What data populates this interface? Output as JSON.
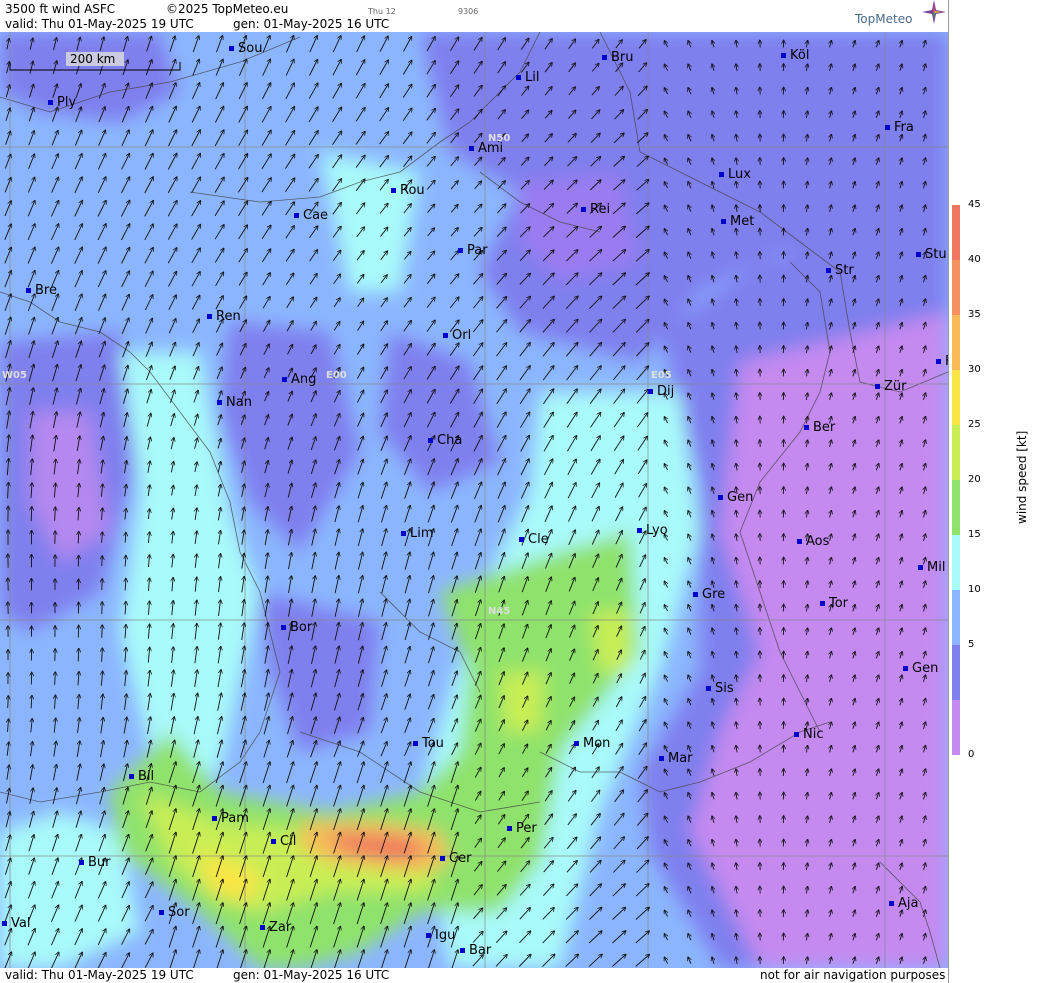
{
  "header": {
    "product": "3500 ft wind ASFC",
    "copyright": "©2025 TopMeteo.eu",
    "valid": "valid:  Thu  01-May-2025  19 UTC",
    "gen": "gen: 01-May-2025 16 UTC",
    "small_label": "Thu 12",
    "small_code": "9306",
    "logo": "TopMeteo"
  },
  "scalebar": {
    "label": "200 km"
  },
  "grid_labels": [
    "N50",
    "N45",
    "W05",
    "E00",
    "E05"
  ],
  "cities": [
    "Sou",
    "Ply",
    "Lil",
    "Bru",
    "Köl",
    "Ami",
    "Fra",
    "Lux",
    "Rou",
    "Cae",
    "Rei",
    "Met",
    "Par",
    "Stu",
    "Bre",
    "Str",
    "Ren",
    "Orl",
    "F",
    "Zür",
    "Ang",
    "Nan",
    "Dij",
    "Cha",
    "Ber",
    "Gen",
    "Lim",
    "Cle",
    "Lyo",
    "Aos",
    "Mil",
    "Gre",
    "Bor",
    "Tor",
    "Gen",
    "Sis",
    "Tou",
    "Mon",
    "Nic",
    "Mar",
    "Bil",
    "Pam",
    "Cil",
    "Per",
    "Cer",
    "Bur",
    "Sor",
    "Zar",
    "Igu",
    "Val",
    "Bar",
    "Aja"
  ],
  "colorbar": {
    "title": "wind speed [kt]",
    "ticks": [
      "45",
      "40",
      "35",
      "30",
      "25",
      "20",
      "15",
      "10",
      "5",
      "0"
    ],
    "colors": [
      "#f07860",
      "#f59060",
      "#f7bc58",
      "#fbe545",
      "#c9ee55",
      "#8fe26c",
      "#a9fafa",
      "#8bb6ff",
      "#7f7fee",
      "#c48af0"
    ]
  },
  "footer": {
    "valid": "valid:  Thu  01-May-2025  19 UTC",
    "gen": "gen: 01-May-2025 16 UTC",
    "note": "not for air navigation purposes"
  }
}
